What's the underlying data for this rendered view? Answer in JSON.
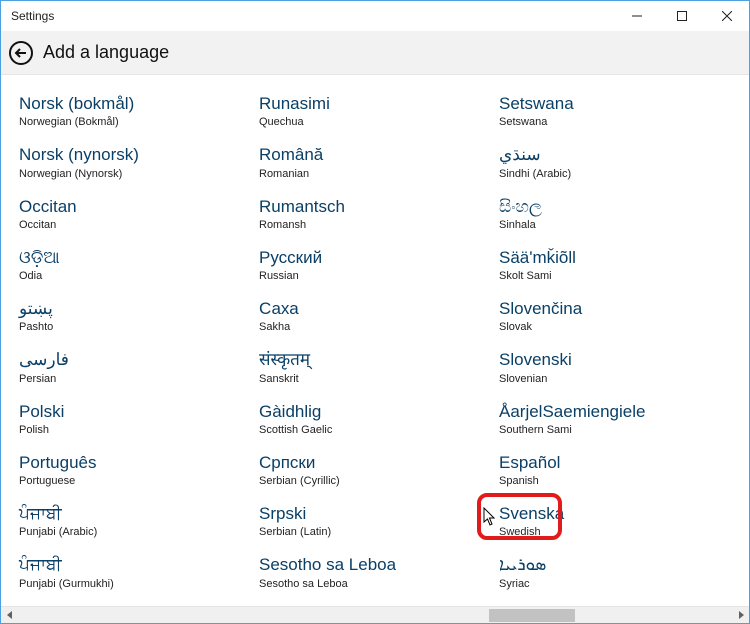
{
  "window": {
    "title": "Settings"
  },
  "header": {
    "page_title": "Add a language"
  },
  "columns": [
    {
      "items": [
        {
          "native": "Norsk (bokmål)",
          "english": "Norwegian (Bokmål)"
        },
        {
          "native": "Norsk (nynorsk)",
          "english": "Norwegian (Nynorsk)"
        },
        {
          "native": "Occitan",
          "english": "Occitan"
        },
        {
          "native": "ଓଡ଼ିଆ",
          "english": "Odia"
        },
        {
          "native": "پښتو",
          "english": "Pashto"
        },
        {
          "native": "فارسى",
          "english": "Persian"
        },
        {
          "native": "Polski",
          "english": "Polish"
        },
        {
          "native": "Português",
          "english": "Portuguese"
        },
        {
          "native": "ਪੰਜਾਬੀ",
          "english": "Punjabi (Arabic)"
        },
        {
          "native": "ਪੰਜਾਬੀ",
          "english": "Punjabi (Gurmukhi)"
        }
      ]
    },
    {
      "items": [
        {
          "native": "Runasimi",
          "english": "Quechua"
        },
        {
          "native": "Română",
          "english": "Romanian"
        },
        {
          "native": "Rumantsch",
          "english": "Romansh"
        },
        {
          "native": "Русский",
          "english": "Russian"
        },
        {
          "native": "Саха",
          "english": "Sakha"
        },
        {
          "native": "संस्कृतम्",
          "english": "Sanskrit"
        },
        {
          "native": "Gàidhlig",
          "english": "Scottish Gaelic"
        },
        {
          "native": "Српски",
          "english": "Serbian (Cyrillic)"
        },
        {
          "native": "Srpski",
          "english": "Serbian (Latin)"
        },
        {
          "native": "Sesotho sa Leboa",
          "english": "Sesotho sa Leboa"
        }
      ]
    },
    {
      "items": [
        {
          "native": "Setswana",
          "english": "Setswana"
        },
        {
          "native": "سنڌي",
          "english": "Sindhi (Arabic)"
        },
        {
          "native": "සිංහල",
          "english": "Sinhala"
        },
        {
          "native": "Sääʹmǩiõll",
          "english": "Skolt Sami"
        },
        {
          "native": "Slovenčina",
          "english": "Slovak"
        },
        {
          "native": "Slovenski",
          "english": "Slovenian"
        },
        {
          "native": "ÅarjelSaemiengiele",
          "english": "Southern Sami"
        },
        {
          "native": "Español",
          "english": "Spanish"
        },
        {
          "native": "Svenska",
          "english": "Swedish"
        },
        {
          "native": "ܣܘܪܝܝܐ",
          "english": "Syriac"
        }
      ]
    }
  ],
  "highlight": {
    "col": 2,
    "row": 8
  },
  "scrollbar": {
    "thumb_left_pct": 66,
    "thumb_width_pct": 12
  }
}
